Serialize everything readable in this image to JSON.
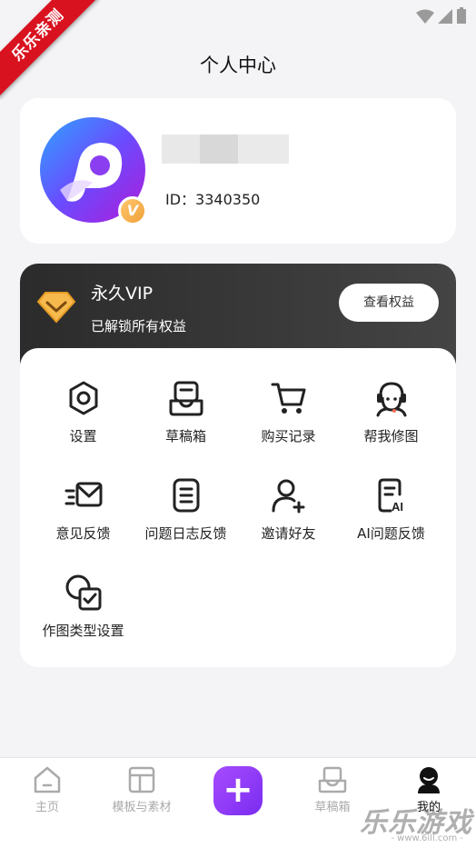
{
  "watermark": {
    "ribbon": "乐乐亲测",
    "logo": "乐乐游戏",
    "url": "- www.6ill.com -"
  },
  "header": {
    "title": "个人中心"
  },
  "profile": {
    "id_label": "ID：3340350",
    "badge": "V"
  },
  "vip": {
    "title": "永久VIP",
    "subtitle": "已解锁所有权益",
    "button": "查看权益"
  },
  "features": [
    {
      "label": "设置",
      "icon": "gear-hexagon-icon"
    },
    {
      "label": "草稿箱",
      "icon": "drafts-inbox-icon"
    },
    {
      "label": "购买记录",
      "icon": "shopping-cart-icon"
    },
    {
      "label": "帮我修图",
      "icon": "customer-service-icon"
    },
    {
      "label": "意见反馈",
      "icon": "mail-feedback-icon"
    },
    {
      "label": "问题日志反馈",
      "icon": "log-document-icon"
    },
    {
      "label": "邀请好友",
      "icon": "add-user-icon"
    },
    {
      "label": "AI问题反馈",
      "icon": "ai-document-icon"
    },
    {
      "label": "作图类型设置",
      "icon": "type-settings-icon"
    }
  ],
  "bottom_nav": [
    {
      "label": "主页",
      "icon": "home-icon",
      "active": false
    },
    {
      "label": "模板与素材",
      "icon": "templates-icon",
      "active": false
    },
    {
      "label": "",
      "icon": "plus-icon",
      "active": false
    },
    {
      "label": "草稿箱",
      "icon": "drafts-icon",
      "active": false
    },
    {
      "label": "我的",
      "icon": "profile-icon",
      "active": true
    }
  ],
  "colors": {
    "accent": "#8b3cf7",
    "vip_gold": "#f5b041",
    "vip_bg": "#333333"
  }
}
